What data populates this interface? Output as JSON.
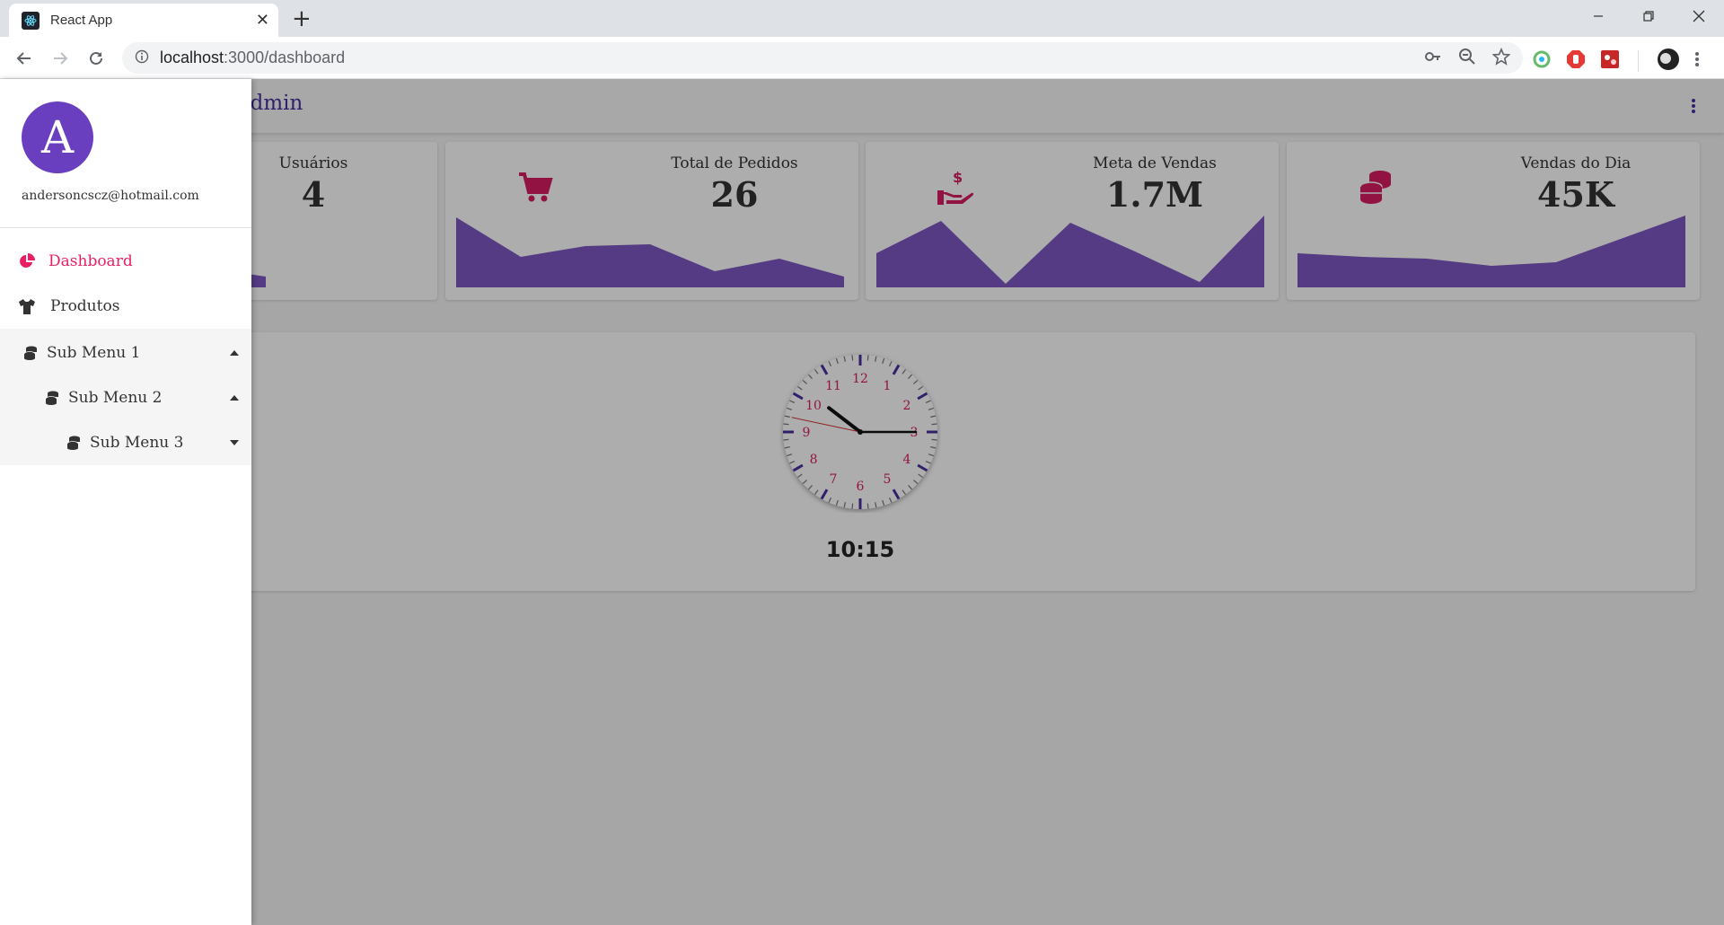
{
  "browser": {
    "tab_title": "React App",
    "new_tab": "+",
    "url_host": "localhost",
    "url_path": ":3000/dashboard"
  },
  "app": {
    "title": "Admin",
    "colors": {
      "accent": "#d81b60",
      "primary": "#5e35b1",
      "chart_fill": "#7e57c2"
    }
  },
  "cards": [
    {
      "label": "Usuários",
      "value": "4",
      "icon": "users-icon"
    },
    {
      "label": "Total de Pedidos",
      "value": "26",
      "icon": "cart-icon"
    },
    {
      "label": "Meta de Vendas",
      "value": "1.7M",
      "icon": "hand-money-icon"
    },
    {
      "label": "Vendas do Dia",
      "value": "45K",
      "icon": "coins-icon"
    }
  ],
  "clock": {
    "numbers": [
      "12",
      "1",
      "2",
      "3",
      "4",
      "5",
      "6",
      "7",
      "8",
      "9",
      "10",
      "11"
    ],
    "time": "10:15"
  },
  "drawer": {
    "avatar_letter": "A",
    "email": "andersoncscz@hotmail.com",
    "items": [
      {
        "label": "Dashboard",
        "icon": "pie-chart-icon",
        "active": true
      },
      {
        "label": "Produtos",
        "icon": "tshirt-icon",
        "active": false
      }
    ],
    "submenus": [
      {
        "label": "Sub Menu 1",
        "icon": "database-icon",
        "state": "expanded"
      },
      {
        "label": "Sub Menu 2",
        "icon": "database-icon",
        "state": "expanded"
      },
      {
        "label": "Sub Menu 3",
        "icon": "database-icon",
        "state": "collapsed"
      }
    ]
  }
}
